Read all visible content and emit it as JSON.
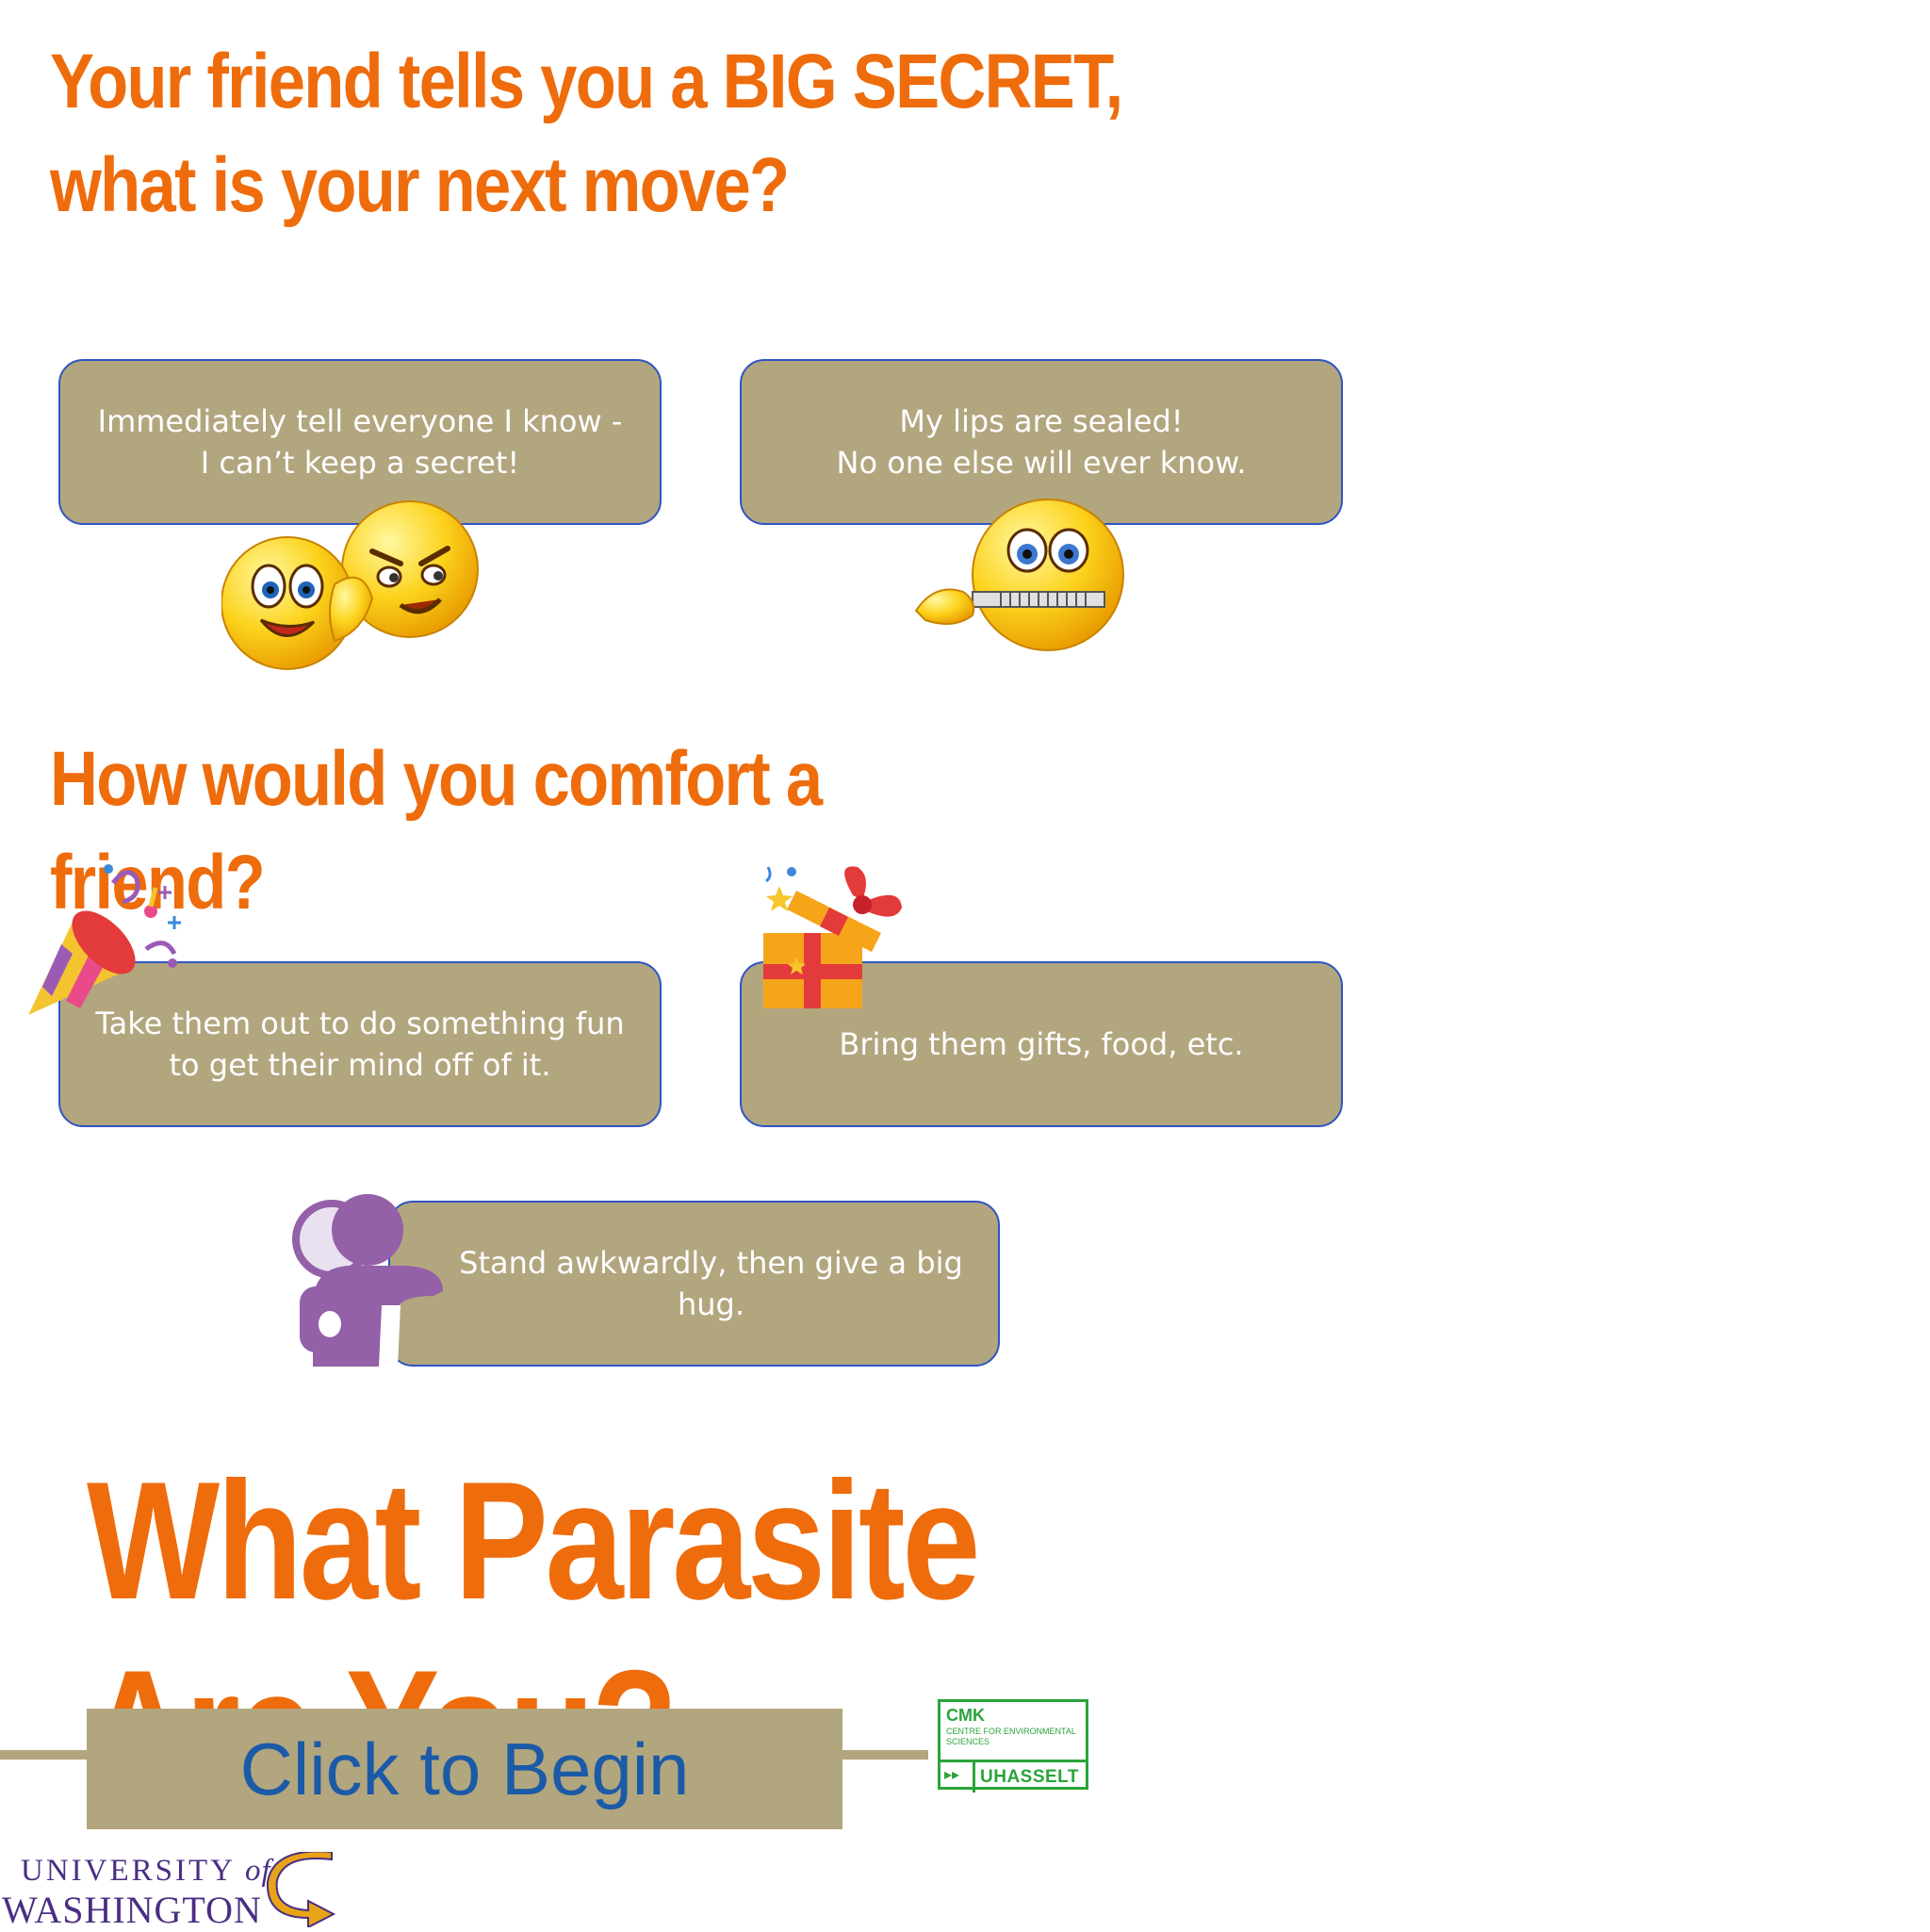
{
  "question1": {
    "title": "Your friend tells you a BIG SECRET, what is your next move?",
    "options": [
      {
        "label": "Immediately tell everyone I know -\nI can’t keep a secret!",
        "icon": "whispering-emoji-icon"
      },
      {
        "label": "My lips are sealed!\nNo one else will ever know.",
        "icon": "zipped-mouth-emoji-icon"
      }
    ]
  },
  "question2": {
    "title": "How would you comfort a friend?",
    "options": [
      {
        "label": "Take them out to do something fun\nto get their mind off of it.",
        "icon": "party-popper-icon"
      },
      {
        "label": "Bring them gifts, food, etc.",
        "icon": "gift-box-icon"
      },
      {
        "label": "Stand awkwardly, then give a big\nhug.",
        "icon": "hug-icon"
      }
    ]
  },
  "quiz_title": "What Parasite Are You?",
  "begin_button": {
    "label": "Click to Begin"
  },
  "logos": {
    "cmk": {
      "top": "CMK",
      "sub": "CENTRE FOR ENVIRONMENTAL SCIENCES",
      "bottom": "UHASSELT"
    },
    "uw": {
      "line1": "UNIVERSITY",
      "of": "of",
      "line2": "WASHINGTON"
    }
  },
  "colors": {
    "accent": "#ee6c0c",
    "option_bg": "#b2a67f",
    "option_border": "#2f55c4",
    "button_text": "#1b5aa7",
    "cmk_green": "#2aa43a",
    "uw_purple": "#4b2e83",
    "uw_gold": "#e8a317"
  }
}
